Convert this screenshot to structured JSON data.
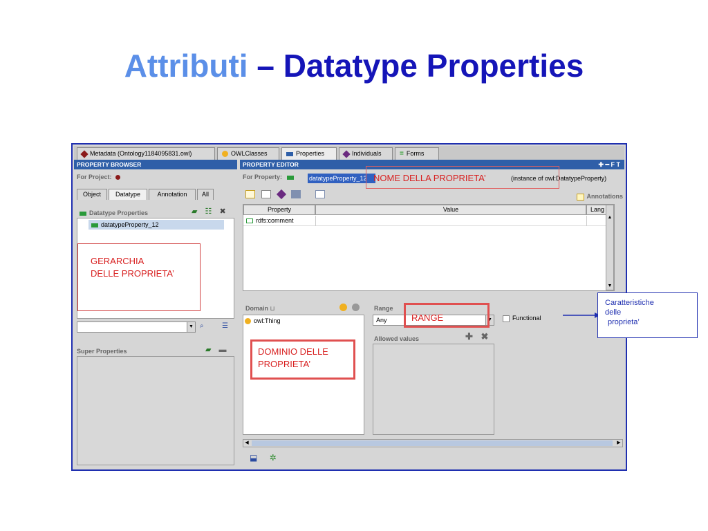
{
  "slide": {
    "title_part1": "Attributi",
    "title_part2": "– Datatype Properties"
  },
  "main_tabs": [
    {
      "label": "Metadata (Ontology1184095831.owl)",
      "icon": "diamond-icon",
      "color": "#8b1a1a"
    },
    {
      "label": "OWLClasses",
      "icon": "circle-icon",
      "color": "#f0b020"
    },
    {
      "label": "Properties",
      "icon": "rect-icon",
      "color": "#2f5fa8"
    },
    {
      "label": "Individuals",
      "icon": "diamond-icon",
      "color": "#6a2a80"
    },
    {
      "label": "Forms",
      "icon": "lines-icon",
      "color": "#2a9a2a"
    }
  ],
  "browser": {
    "header": "PROPERTY BROWSER",
    "for_project": "For Project:",
    "tabs": [
      "Object",
      "Datatype",
      "Annotation",
      "All"
    ],
    "section_title": "Datatype Properties",
    "items": [
      "datatypeProperty_12"
    ],
    "super_properties": "Super Properties"
  },
  "editor": {
    "header": "PROPERTY EDITOR",
    "for_property": "For Property:",
    "property_name": "datatypeProperty_12",
    "instance_of": "(instance of owl:DatatypeProperty)",
    "annotations": "Annotations",
    "table_headers": [
      "Property",
      "Value",
      "Lang"
    ],
    "table_rows": [
      {
        "property": "rdfs:comment",
        "value": "",
        "lang": ""
      }
    ],
    "domain_label": "Domain",
    "domain_items": [
      "owl:Thing"
    ],
    "range_label": "Range",
    "range_value": "Any",
    "functional_label": "Functional",
    "allowed_values": "Allowed values"
  },
  "annotations": {
    "nome": "NOME DELLA PROPRIETA’",
    "gerarchia_line1": "GERARCHIA",
    "gerarchia_line2": "DELLE PROPRIETA’",
    "dominio_line1": "DOMINIO DELLE",
    "dominio_line2": "PROPRIETA’",
    "range": "RANGE",
    "caratteristiche_line1": "Caratteristiche",
    "caratteristiche_line2": "delle",
    "caratteristiche_line3": "proprieta’"
  },
  "colors": {
    "title_light": "#5b8fe8",
    "title_dark": "#1515b8",
    "header_blue": "#2f5fa8",
    "annotation_red": "#d82020",
    "frame_blue": "#1f2fb0"
  }
}
